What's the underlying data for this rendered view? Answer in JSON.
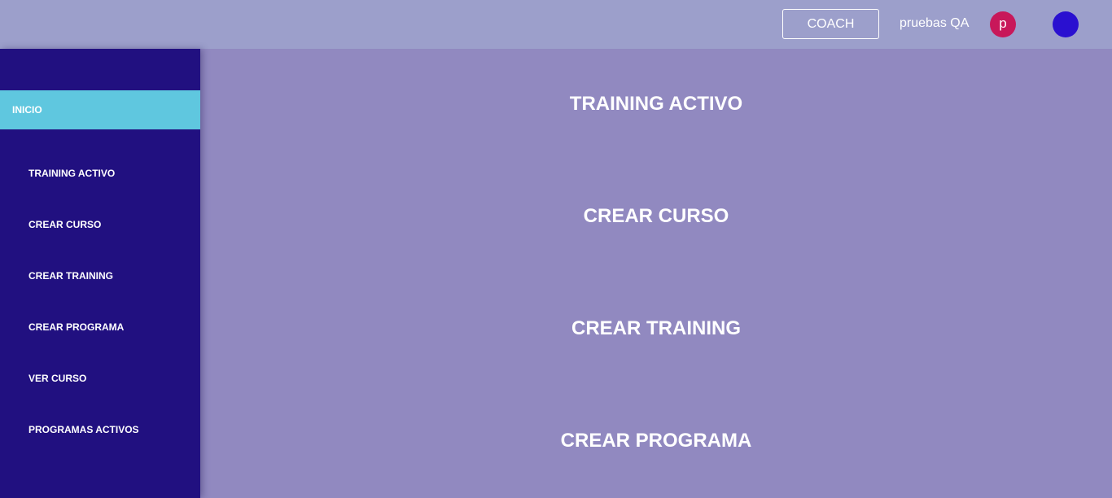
{
  "header": {
    "role_button": "COACH",
    "username": "pruebas QA",
    "avatar_initial": "p",
    "avatar_color": "#c8185a",
    "status_dot_color": "#2a10d0"
  },
  "sidebar": {
    "active_item": "INICIO",
    "items": [
      {
        "label": "TRAINING ACTIVO"
      },
      {
        "label": "CREAR CURSO"
      },
      {
        "label": "CREAR TRAINING"
      },
      {
        "label": "CREAR PROGRAMA"
      },
      {
        "label": "VER CURSO"
      },
      {
        "label": "PROGRAMAS ACTIVOS"
      }
    ]
  },
  "main": {
    "links": [
      {
        "label": "TRAINING ACTIVO"
      },
      {
        "label": "CREAR CURSO"
      },
      {
        "label": "CREAR TRAINING"
      },
      {
        "label": "CREAR PROGRAMA"
      }
    ]
  },
  "colors": {
    "topbar": "#9c9fcb",
    "sidebar": "#211080",
    "active_item": "#5fc7df",
    "main_background": "#9189c0"
  }
}
